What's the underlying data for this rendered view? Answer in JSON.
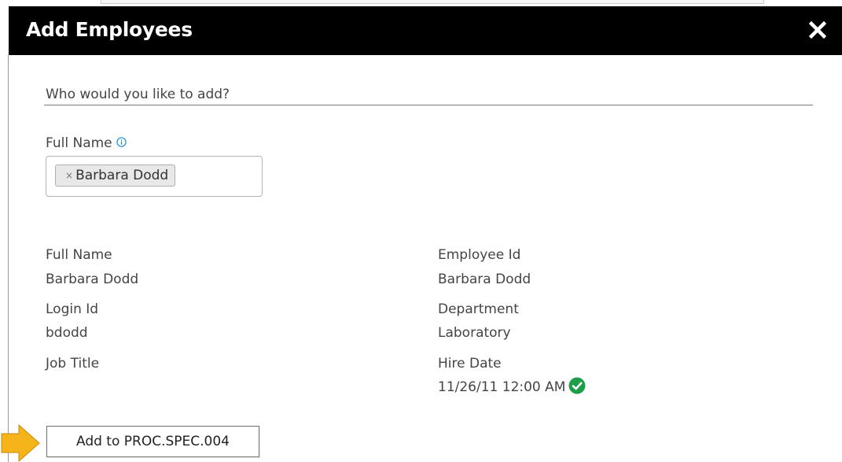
{
  "dialog": {
    "title": "Add Employees",
    "close_icon": "close-icon",
    "close_glyph": "✕"
  },
  "form": {
    "prompt": "Who would you like to add?",
    "full_name_label": "Full Name",
    "info_icon": "info-icon",
    "selected_chip": {
      "remove_glyph": "×",
      "label": "Barbara Dodd"
    }
  },
  "details": {
    "left": [
      {
        "label": "Full Name",
        "value": "Barbara Dodd"
      },
      {
        "label": "Login Id",
        "value": "bdodd"
      },
      {
        "label": "Job Title",
        "value": ""
      }
    ],
    "right": [
      {
        "label": "Employee Id",
        "value": "Barbara Dodd"
      },
      {
        "label": "Department",
        "value": "Laboratory"
      },
      {
        "label": "Hire Date",
        "value": "11/26/11 12:00 AM"
      }
    ],
    "hire_date_status_icon": "check-circle-icon"
  },
  "actions": {
    "add_button_label": "Add to PROC.SPEC.004"
  },
  "colors": {
    "titlebar": "#000000",
    "info_icon": "#1a8fd6",
    "check": "#1e9e4a",
    "arrow": "#f4b41a"
  }
}
